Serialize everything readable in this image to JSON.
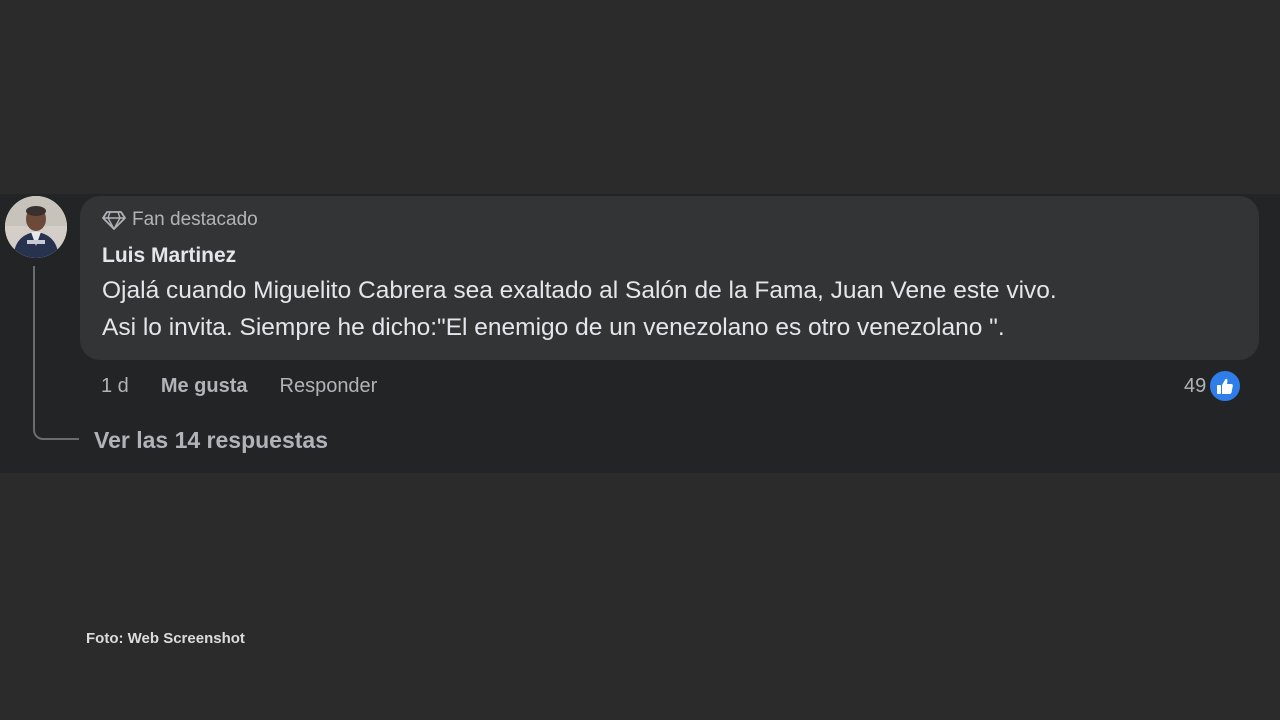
{
  "comment": {
    "badge_label": "Fan destacado",
    "badge_icon": "diamond-icon",
    "author": "Luis Martinez",
    "text_lines": [
      "Ojalá cuando Miguelito Cabrera sea exaltado al Salón de la Fama, Juan Vene este vivo.",
      "Asi lo invita. Siempre he dicho:\"El enemigo de un venezolano es otro venezolano \"."
    ],
    "age": "1 d",
    "like_label": "Me gusta",
    "reply_label": "Responder",
    "reaction_count": "49",
    "reaction_icon": "thumbs-up-icon",
    "view_replies_label": "Ver las 14 respuestas"
  },
  "caption": "Foto: Web Screenshot",
  "colors": {
    "background": "#2b2b2b",
    "strip": "#232425",
    "bubble": "#333435",
    "text": "#e4e6eb",
    "secondary_text": "#b0b3b8",
    "like_blue": "#2e7de9"
  }
}
